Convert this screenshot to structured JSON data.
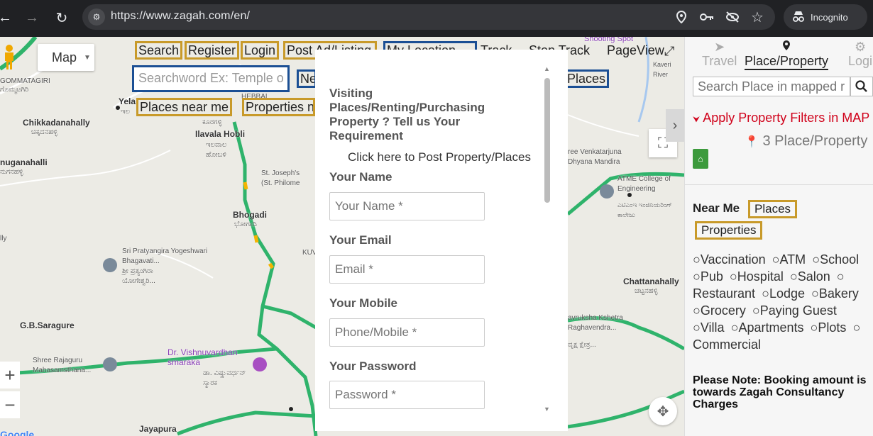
{
  "browser": {
    "url": "https://www.zagah.com/en/",
    "profile_label": "Incognito",
    "icons": [
      "back-icon",
      "forward-icon",
      "reload-icon",
      "site-info-icon",
      "location-icon",
      "key-icon",
      "eye-off-icon",
      "star-icon",
      "incognito-icon"
    ]
  },
  "map": {
    "type_control": "Map",
    "toolbar": {
      "search": "Search",
      "register": "Register",
      "login": "Login",
      "post_ad": "Post Ad/Listing",
      "my_location": "My Location",
      "track": "Track",
      "stop_track": "Stop Track",
      "page_view": "PageView",
      "places_near_me": "Places near me",
      "properties_near": "Properties n",
      "ne": "Ne",
      "places": "Places"
    },
    "search_placeholder": "Searchword Ex: Temple o",
    "labels": {
      "gommatagiri": "GOMMATAGIRI",
      "gommatagiri_kn": "ಗೊಮ್ಮಟಗಿರಿ",
      "yela": "Yela",
      "yela_kn": "ಇಲ",
      "chikkadanahally": "Chikkadanahally",
      "chikkadanahally_kn": "ಚಿಕ್ಕದನಹಳ್ಳಿ",
      "ilavala_kn_top": "ಕೂರಗಳ್ಳಿ",
      "ilavala": "Ilavala Hobli",
      "ilavala_kn": "ಇಲವಾಲ ಹೋಬಳಿ",
      "nuganahalli": "nuganahalli",
      "nuganahalli_kn": "ನುಗನಹಳ್ಳಿ",
      "hebbal": "HEBBAL",
      "stjoseph": "St. Joseph's",
      "stphilomena": "(St. Philome",
      "bhogadi": "Bhogadi",
      "bhogadi_kn": "ಭೋಗಾದಿ",
      "lly": "lly",
      "pratyangira": "Sri Pratyangira Yogeshwari Bhagavati...",
      "pratyangira_kn": "ಶ್ರೀ ಪ್ರತ್ಯಂಗಿರಾ ಯೋಗೇಶ್ವರಿ...",
      "kuv": "KUV",
      "saragure": "G.B.Saragure",
      "rajaguru": "Shree Rajaguru Mahasamsthana...",
      "vishnuvardhan": "Dr. Vishnuvardhan smaraka",
      "vishnuvardhan_kn": "ಡಾ. ವಿಷ್ಣುವರ್ಧನ್ ಸ್ಮಾರಕ",
      "jayapura": "Jayapura",
      "shooting": "Shooting Spot",
      "kaveri": "Kaveri River",
      "venkatarjuna": "ree Venkatarjuna Dhyana Mandira",
      "atme": "ATME College of Engineering",
      "atme_kn": "ಎಟಿಎಂಇ ಇಂಜಿನಿಯರಿಂಗ್ ಕಾಲೇಜು",
      "chattanahally": "Chattanahally",
      "chattanahally_kn": "ಚಟ್ಟನಹಳ್ಳಿ",
      "vruksha": "avruksha Kshetra Raghavendra...",
      "vruksha_kn": "ವೃಕ್ಷ ಕ್ಷೇತ್ರ...",
      "google": "Google"
    }
  },
  "modal": {
    "heading": "Visiting Places/Renting/Purchasing Property ? Tell us Your Requirement",
    "post_link": "Click here to Post Property/Places",
    "fields": [
      {
        "label": "Your Name",
        "placeholder": "Your Name *"
      },
      {
        "label": "Your Email",
        "placeholder": "Email *"
      },
      {
        "label": "Your Mobile",
        "placeholder": "Phone/Mobile *"
      },
      {
        "label": "Your Password",
        "placeholder": "Password *"
      }
    ]
  },
  "panel": {
    "tabs": [
      {
        "label": "Travel",
        "icon": "navigation-icon"
      },
      {
        "label": "Place/Property",
        "icon": "pin-icon"
      },
      {
        "label": "Logi",
        "icon": "gear-icon"
      }
    ],
    "search_placeholder": "Search Place in mapped r",
    "filter_link": "Apply Property Filters in MAP",
    "count": "3 Place/Property",
    "near_me": "Near Me",
    "places_btn": "Places",
    "properties_btn": "Properties",
    "amenities": [
      "Vaccination",
      "ATM",
      "School",
      "Pub",
      "Hospital",
      "Salon",
      "Restaurant",
      "Lodge",
      "Bakery",
      "Grocery",
      "Paying Guest",
      "Villa",
      "Apartments",
      "Plots",
      "Commercial"
    ],
    "note": "Please Note: Booking amount is towards Zagah Consultancy Charges"
  }
}
